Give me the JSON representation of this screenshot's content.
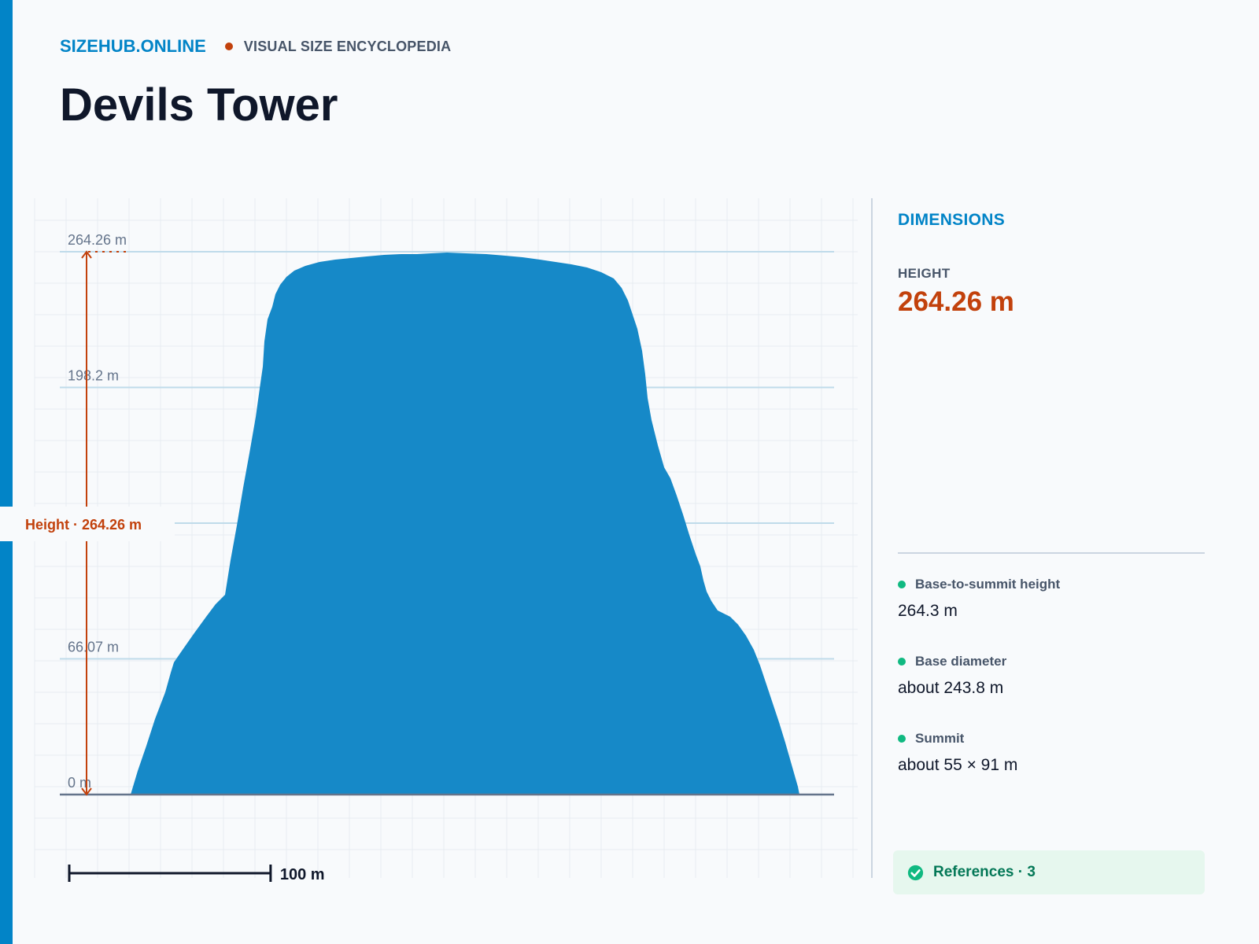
{
  "header": {
    "brand": "SIZEHUB.ONLINE",
    "tagline": "VISUAL SIZE ENCYCLOPEDIA",
    "title": "Devils Tower"
  },
  "diagram": {
    "height_m": 264.26,
    "tick_values": [
      0,
      66.07,
      198.2,
      264.26
    ],
    "tick_labels": [
      "0 m",
      "66.07 m",
      "198.2 m",
      "264.26 m"
    ],
    "height_callout": "Height · 264.26 m",
    "scale_bar_m": 100,
    "scale_bar_label": "100 m",
    "colors": {
      "silhouette": "#1689c8",
      "measure": "#c2410c",
      "gridline": "#bfdbea"
    }
  },
  "panel": {
    "heading": "DIMENSIONS",
    "height_label": "HEIGHT",
    "height_value": "264.26 m",
    "facts": [
      {
        "label": "Base-to-summit height",
        "value": "264.3 m"
      },
      {
        "label": "Base diameter",
        "value": "about 243.8 m"
      },
      {
        "label": "Summit",
        "value": "about 55 × 91 m"
      }
    ],
    "references": "References · 3",
    "colors": {
      "accent": "#0284c7",
      "highlight": "#c2410c",
      "fact_dot": "#10b981"
    }
  }
}
